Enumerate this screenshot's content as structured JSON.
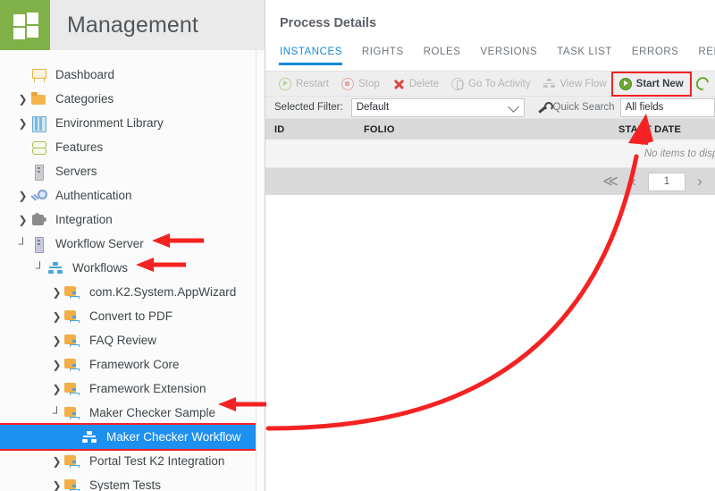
{
  "accent": {
    "brand_green": "#80b048",
    "tab_blue": "#1688d4",
    "selection_blue": "#1e90f0",
    "annotation_red": "#f42222",
    "grid_header_gray": "#d9d9d9"
  },
  "sidebar": {
    "logo_icon": "app-grid-icon",
    "title": "Management",
    "items": [
      {
        "label": "Dashboard",
        "icon": "dashboard-icon",
        "twisty": "",
        "indent": 0,
        "selected": false
      },
      {
        "label": "Categories",
        "icon": "folder-icon",
        "twisty": ">",
        "indent": 0,
        "selected": false
      },
      {
        "label": "Environment Library",
        "icon": "environment-library-icon",
        "twisty": ">",
        "indent": 0,
        "selected": false
      },
      {
        "label": "Features",
        "icon": "features-icon",
        "twisty": "",
        "indent": 0,
        "selected": false
      },
      {
        "label": "Servers",
        "icon": "server-icon",
        "twisty": "",
        "indent": 0,
        "selected": false
      },
      {
        "label": "Authentication",
        "icon": "key-icon",
        "twisty": ">",
        "indent": 0,
        "selected": false
      },
      {
        "label": "Integration",
        "icon": "puzzle-icon",
        "twisty": ">",
        "indent": 0,
        "selected": false
      },
      {
        "label": "Workflow Server",
        "icon": "workflow-server-icon",
        "twisty": "⌐",
        "indent": 0,
        "selected": false
      },
      {
        "label": "Workflows",
        "icon": "workflows-icon",
        "twisty": "⌐",
        "indent": 1,
        "selected": false
      },
      {
        "label": "com.K2.System.AppWizard",
        "icon": "workflow-folder-icon",
        "twisty": ">",
        "indent": 2,
        "selected": false
      },
      {
        "label": "Convert to PDF",
        "icon": "workflow-folder-icon",
        "twisty": ">",
        "indent": 2,
        "selected": false
      },
      {
        "label": "FAQ Review",
        "icon": "workflow-folder-icon",
        "twisty": ">",
        "indent": 2,
        "selected": false
      },
      {
        "label": "Framework Core",
        "icon": "workflow-folder-icon",
        "twisty": ">",
        "indent": 2,
        "selected": false
      },
      {
        "label": "Framework Extension",
        "icon": "workflow-folder-icon",
        "twisty": ">",
        "indent": 2,
        "selected": false
      },
      {
        "label": "Maker Checker Sample",
        "icon": "workflow-folder-icon",
        "twisty": "⌐",
        "indent": 2,
        "selected": false
      },
      {
        "label": "Maker Checker Workflow",
        "icon": "workflow-leaf-icon",
        "twisty": "",
        "indent": 3,
        "selected": true
      },
      {
        "label": "Portal Test K2 Integration",
        "icon": "workflow-folder-icon",
        "twisty": ">",
        "indent": 2,
        "selected": false
      },
      {
        "label": "System Tests",
        "icon": "workflow-folder-icon",
        "twisty": ">",
        "indent": 2,
        "selected": false
      }
    ]
  },
  "main": {
    "page_title": "Process Details",
    "tabs": [
      {
        "label": "INSTANCES",
        "active": true
      },
      {
        "label": "RIGHTS",
        "active": false
      },
      {
        "label": "ROLES",
        "active": false
      },
      {
        "label": "VERSIONS",
        "active": false
      },
      {
        "label": "TASK LIST",
        "active": false
      },
      {
        "label": "ERRORS",
        "active": false
      },
      {
        "label": "REPORTS",
        "active": false
      }
    ],
    "toolbar": [
      {
        "label": "Restart",
        "icon": "play-circle-icon",
        "state": "disabled",
        "highlighted": false
      },
      {
        "label": "Stop",
        "icon": "stop-circle-icon",
        "state": "disabled",
        "highlighted": false
      },
      {
        "label": "Delete",
        "icon": "delete-x-icon",
        "state": "disabled",
        "highlighted": false
      },
      {
        "label": "Go To Activity",
        "icon": "go-to-activity-icon",
        "state": "disabled",
        "highlighted": false
      },
      {
        "label": "View Flow",
        "icon": "view-flow-icon",
        "state": "disabled",
        "highlighted": false
      },
      {
        "label": "Start New",
        "icon": "start-new-play-icon",
        "state": "enabled",
        "highlighted": true
      },
      {
        "label": "",
        "icon": "refresh-icon",
        "state": "enabled",
        "highlighted": false
      }
    ],
    "filter": {
      "label": "Selected Filter:",
      "value": "Default",
      "dropdown_icon": "chevron-down-icon"
    },
    "quick_search": {
      "icon": "wrench-icon",
      "label": "Quick Search",
      "field_value": "All fields"
    },
    "grid": {
      "columns": [
        "ID",
        "FOLIO",
        "START DATE"
      ],
      "rows": [],
      "empty_message": "No items to display"
    },
    "pager": {
      "first_icon": "chevron-first-icon",
      "prev_icon": "chevron-prev-icon",
      "page": "1",
      "next_icon": "chevron-next-icon"
    }
  },
  "annotations": {
    "arrow_workflow_server": "arrow-pointing-left-at-workflow-server",
    "arrow_workflows": "arrow-pointing-left-at-workflows",
    "arrow_maker_checker_sample": "arrow-pointing-left-at-maker-checker-sample",
    "curved_arrow": "curved-arrow-from-selected-workflow-to-start-new-button",
    "highlight_box_selected_item": "red-box-around-maker-checker-workflow",
    "highlight_box_start_new": "red-box-around-start-new-button"
  }
}
